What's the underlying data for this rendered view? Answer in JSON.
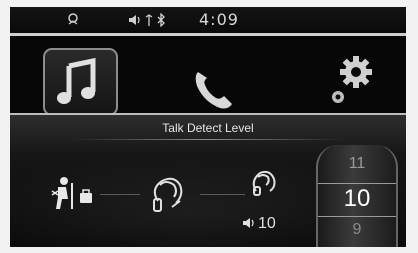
{
  "status_bar": {
    "time": "4:09",
    "icons": [
      "handsfree-status-icon",
      "volume-icon",
      "phone-signal-icon",
      "bluetooth-icon"
    ]
  },
  "home": {
    "tiles": [
      "music-icon",
      "phone-icon",
      "settings-gear-icon"
    ]
  },
  "talk_detect": {
    "title": "Talk Detect Level",
    "options": [
      "rear-passenger-talk-icon",
      "headset-talk-icon",
      "talk-volume-icon"
    ],
    "current_volume": "10",
    "wheel": {
      "prev": "11",
      "current": "10",
      "next": "9"
    }
  },
  "colors": {
    "background": "#060606",
    "text": "#e6e6e6",
    "accent": "#ffffff"
  }
}
